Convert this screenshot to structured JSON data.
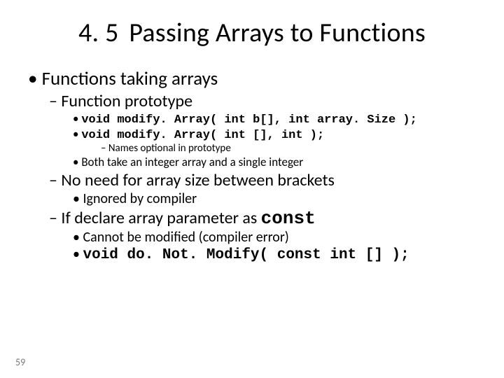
{
  "title_num": "4. 5",
  "title_text": "Passing Arrays to Functions",
  "bullets": {
    "l1_a": "Functions taking arrays",
    "l2_a": "Function prototype",
    "code1": "void modify. Array( int b[], int array. Size );",
    "code2": "void modify. Array( int [], int );",
    "l4_a": "Names optional in prototype",
    "l3_a": "Both take an integer array and a single integer",
    "l2_b": "No need for array size between brackets",
    "l3_b": "Ignored by compiler",
    "l2_c_pre": "If declare array parameter as ",
    "l2_c_code": "const",
    "l3_c": "Cannot be modified (compiler error)",
    "code3": "void do. Not. Modify( const int [] );"
  },
  "page_number": "59"
}
